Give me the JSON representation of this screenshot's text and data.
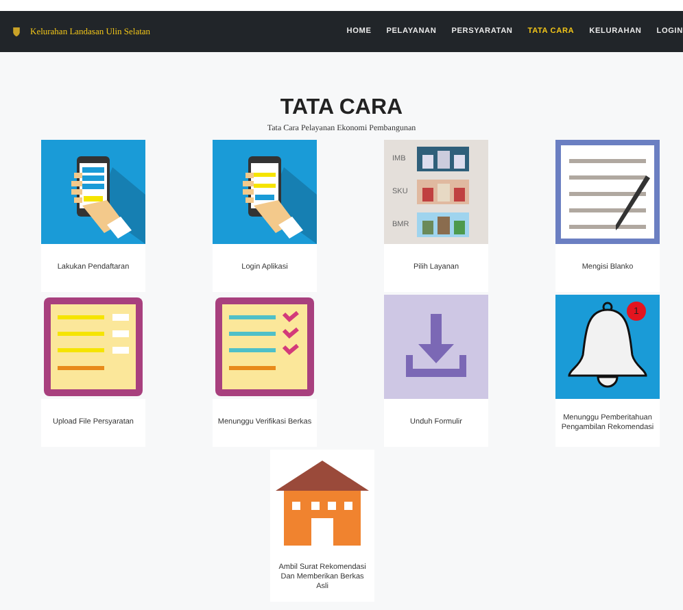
{
  "navbar": {
    "brand": "Kelurahan Landasan Ulin Selatan",
    "menu": [
      {
        "label": "HOME",
        "selected": false
      },
      {
        "label": "PELAYANAN",
        "selected": false
      },
      {
        "label": "PERSYARATAN",
        "selected": false
      },
      {
        "label": "TATA CARA",
        "selected": true
      },
      {
        "label": "KELURAHAN",
        "selected": false
      },
      {
        "label": "LOGIN",
        "selected": false
      }
    ]
  },
  "heading": "TATA CARA",
  "subheading": "Tata Cara Pelayanan Ekonomi Pembangunan",
  "steps": [
    {
      "kind": "register",
      "label": "Lakukan Pendaftaran"
    },
    {
      "kind": "login",
      "label": "Login Aplikasi"
    },
    {
      "kind": "services",
      "label": "Pilih Layanan",
      "image_labels": [
        "IMB",
        "SKU",
        "BMR"
      ]
    },
    {
      "kind": "form",
      "label": "Mengisi Blanko"
    },
    {
      "kind": "upload",
      "label": "Upload File Persyaratan"
    },
    {
      "kind": "verify",
      "label": "Menunggu Verifikasi Berkas"
    },
    {
      "kind": "download",
      "label": "Unduh Formulir"
    },
    {
      "kind": "bell",
      "label": "Menunggu Pemberitahuan Pengambilan Rekomendasi",
      "badge": "1"
    },
    {
      "kind": "house",
      "label": "Ambil Surat Rekomendasi Dan Memberikan Berkas Asli"
    }
  ]
}
